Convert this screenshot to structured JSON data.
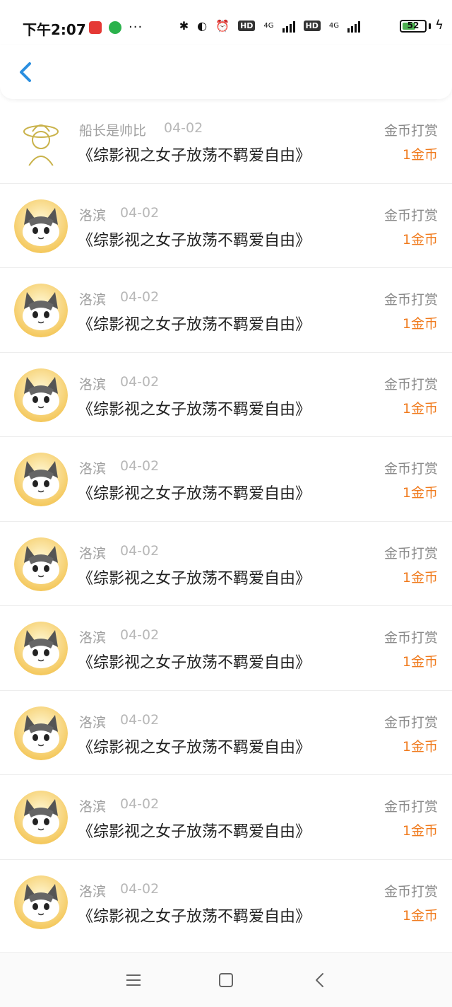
{
  "status": {
    "time": "下午2:07",
    "more": "···",
    "battery": "52",
    "hd1": "HD",
    "hd2": "HD",
    "net1": "4G",
    "net2": "4G"
  },
  "rows": [
    {
      "name": "船长是帅比",
      "date": "04-02",
      "title": "《综影视之女子放荡不羁爱自由》",
      "reward_type": "金币打赏",
      "reward_amount": "1金币",
      "avatar": "captain-avatar"
    },
    {
      "name": "洛滨",
      "date": "04-02",
      "title": "《综影视之女子放荡不羁爱自由》",
      "reward_type": "金币打赏",
      "reward_amount": "1金币",
      "avatar": "cat-avatar"
    },
    {
      "name": "洛滨",
      "date": "04-02",
      "title": "《综影视之女子放荡不羁爱自由》",
      "reward_type": "金币打赏",
      "reward_amount": "1金币",
      "avatar": "cat-avatar"
    },
    {
      "name": "洛滨",
      "date": "04-02",
      "title": "《综影视之女子放荡不羁爱自由》",
      "reward_type": "金币打赏",
      "reward_amount": "1金币",
      "avatar": "cat-avatar"
    },
    {
      "name": "洛滨",
      "date": "04-02",
      "title": "《综影视之女子放荡不羁爱自由》",
      "reward_type": "金币打赏",
      "reward_amount": "1金币",
      "avatar": "cat-avatar"
    },
    {
      "name": "洛滨",
      "date": "04-02",
      "title": "《综影视之女子放荡不羁爱自由》",
      "reward_type": "金币打赏",
      "reward_amount": "1金币",
      "avatar": "cat-avatar"
    },
    {
      "name": "洛滨",
      "date": "04-02",
      "title": "《综影视之女子放荡不羁爱自由》",
      "reward_type": "金币打赏",
      "reward_amount": "1金币",
      "avatar": "cat-avatar"
    },
    {
      "name": "洛滨",
      "date": "04-02",
      "title": "《综影视之女子放荡不羁爱自由》",
      "reward_type": "金币打赏",
      "reward_amount": "1金币",
      "avatar": "cat-avatar"
    },
    {
      "name": "洛滨",
      "date": "04-02",
      "title": "《综影视之女子放荡不羁爱自由》",
      "reward_type": "金币打赏",
      "reward_amount": "1金币",
      "avatar": "cat-avatar"
    },
    {
      "name": "洛滨",
      "date": "04-02",
      "title": "《综影视之女子放荡不羁爱自由》",
      "reward_type": "金币打赏",
      "reward_amount": "1金币",
      "avatar": "cat-avatar"
    }
  ],
  "colors": {
    "accent_blue": "#2b8fe0",
    "reward_orange": "#f07b1e",
    "meta_gray": "#a0a0a0"
  }
}
